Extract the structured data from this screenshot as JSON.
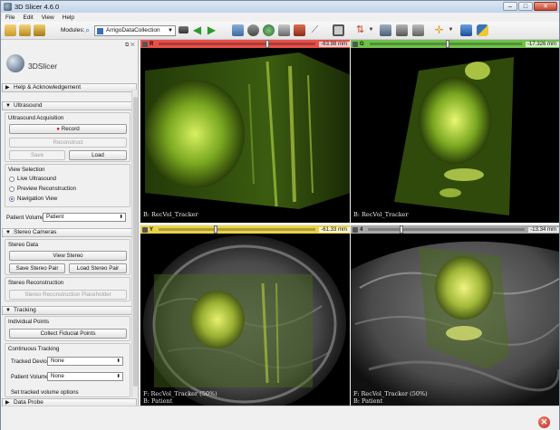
{
  "window": {
    "title": "3D Slicer 4.6.0",
    "min": "–",
    "max": "□",
    "close": "✕"
  },
  "menu": [
    "File",
    "Edit",
    "View",
    "Help"
  ],
  "toolbar": {
    "modules_label": "Modules:",
    "module": "ArrigoDataCollection"
  },
  "panel": {
    "logo_text": "3DSlicer",
    "sections": {
      "help": "Help & Acknowledgement",
      "ultrasound": "Ultrasound",
      "stereo": "Stereo Cameras",
      "tracking": "Tracking",
      "probe": "Data Probe"
    },
    "us_acq": {
      "title": "Ultrasound Acquisition",
      "record": "Record",
      "reconstruct": "Reconstruct",
      "save": "Save",
      "load": "Load"
    },
    "view_sel": {
      "title": "View Selection",
      "options": [
        "Live Ultrasound",
        "Preview Reconstruction",
        "Navigation View"
      ],
      "selected": 2
    },
    "patient_volume": {
      "label": "Patient Volume:",
      "value": "Patient"
    },
    "stereo_data": {
      "title": "Stereo Data",
      "view": "View Stereo",
      "save_pair": "Save Stereo Pair",
      "load_pair": "Load Stereo Pair"
    },
    "stereo_recon": {
      "title": "Stereo Reconstruction",
      "placeholder": "Stereo Reconstruction Placeholder"
    },
    "indiv_points": {
      "title": "Individual Points",
      "collect": "Collect Fiducial Points"
    },
    "continuous": {
      "title": "Continuous Tracking",
      "tracked_device_label": "Tracked Device:",
      "tracked_device": "None",
      "patient_volume_label": "Patient Volume:",
      "patient_volume": "None",
      "set_opts": "Set tracked volume options"
    }
  },
  "views": {
    "red": {
      "letter": "R",
      "value": "-63.98 mm",
      "color": "#e8504a",
      "slider": 0.68,
      "text_f": "",
      "text_b": "B: RecVol_Tracker"
    },
    "green": {
      "letter": "G",
      "value": "-17.326 mm",
      "color": "#6fc14a",
      "slider": 0.5,
      "text_f": "",
      "text_b": "B: RecVol_Tracker"
    },
    "yellow": {
      "letter": "Y",
      "value": "-61.33 mm",
      "color": "#e7d24a",
      "slider": 0.35,
      "text_f": "F: RecVol_Tracker (50%)",
      "text_b": "B: Patient"
    },
    "gray": {
      "letter": "4",
      "value": "-13.34 mm",
      "color": "#a8a8a8",
      "slider": 0.2,
      "text_f": "F: RecVol_Tracker (50%)",
      "text_b": "B: Patient"
    }
  },
  "colors": {
    "red": "#e8504a",
    "green": "#6fc14a",
    "yellow": "#e7d24a",
    "gray": "#a8a8a8"
  }
}
